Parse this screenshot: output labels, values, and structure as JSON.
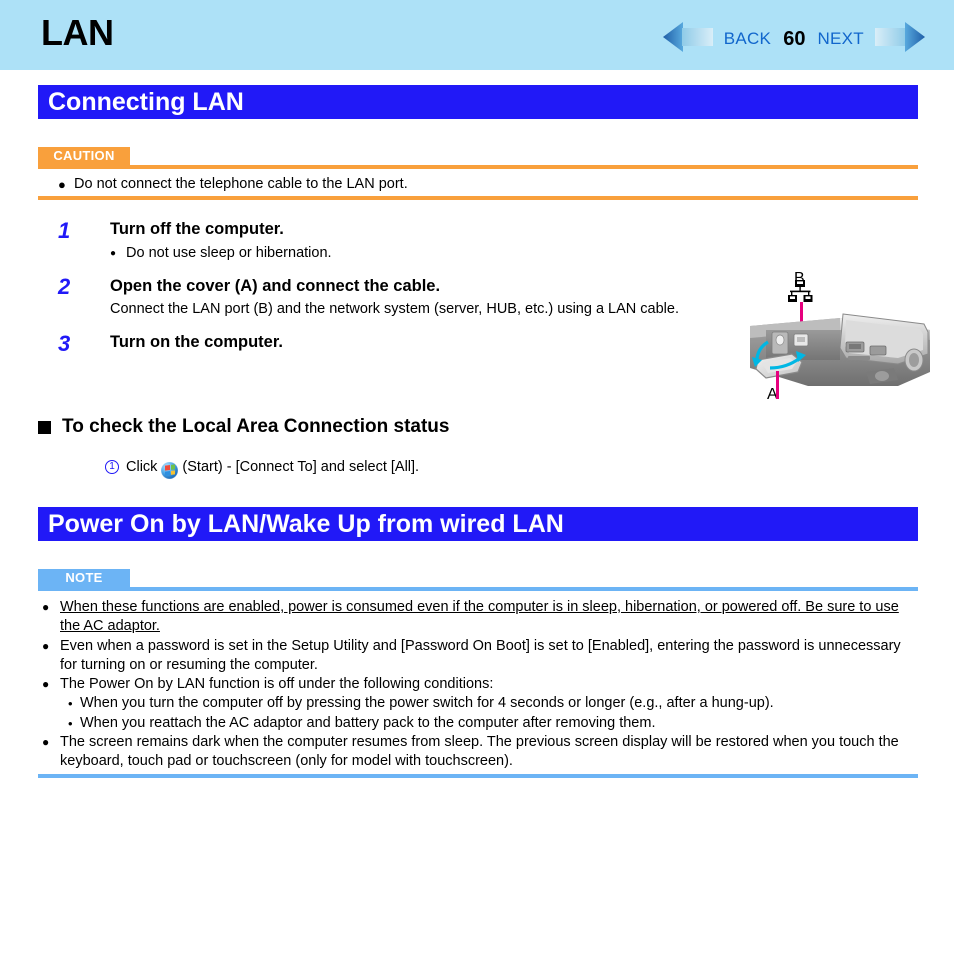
{
  "header": {
    "title": "LAN",
    "back_label": "BACK",
    "page_number": "60",
    "next_label": "NEXT",
    "band_color": "#ade1f7",
    "link_color": "#1166cc"
  },
  "sections": {
    "connecting": {
      "bar_title": "Connecting LAN",
      "bar_color": "#2119f7",
      "caution": {
        "tag": "CAUTION",
        "tag_color": "#f9a03c",
        "items": [
          "Do not connect the telephone cable to the LAN port."
        ]
      },
      "steps": [
        {
          "number": "1",
          "title": "Turn off the computer.",
          "bullet": "Do not use sleep or hibernation."
        },
        {
          "number": "2",
          "title": "Open the cover (A) and connect the cable.",
          "sub": "Connect the LAN port (B) and the network system (server, HUB, etc.) using a LAN cable."
        },
        {
          "number": "3",
          "title": "Turn on the computer."
        }
      ],
      "subsection": {
        "heading": "To check the Local Area Connection status",
        "step_marker": "1",
        "step_text_before": "Click",
        "step_text_after": "(Start) - [Connect To] and select [All]."
      }
    },
    "power_on": {
      "bar_title": "Power On by LAN/Wake Up from wired LAN",
      "bar_color": "#2119f7",
      "note": {
        "tag": "NOTE",
        "tag_color": "#6cb4f5",
        "bullets": [
          {
            "text": "When these functions are enabled, power is consumed even if the computer is in sleep, hibernation, or powered off. Be sure to use the AC adaptor.",
            "underline": true,
            "subitems": []
          },
          {
            "text": "Even when a password is set in the Setup Utility and [Password On Boot] is set to [Enabled], entering the password is unnecessary for turning on or resuming the computer.",
            "underline": false,
            "subitems": []
          },
          {
            "text": "The Power On by LAN function is off under the following conditions:",
            "underline": false,
            "subitems": [
              "When you turn the computer off by pressing the power switch for 4 seconds or longer (e.g., after a hung-up).",
              "When you reattach the AC adaptor and battery pack to the computer after removing them."
            ]
          },
          {
            "text": "The screen remains dark when the computer resumes from sleep. The previous screen display will be restored when you touch the keyboard, touch pad or touchscreen (only for model with touchscreen).",
            "underline": false,
            "subitems": []
          }
        ]
      }
    }
  },
  "illustration": {
    "label_a": "A",
    "label_b": "B",
    "pointer_color": "#e6007e",
    "description": "laptop-rear-port-cover"
  }
}
